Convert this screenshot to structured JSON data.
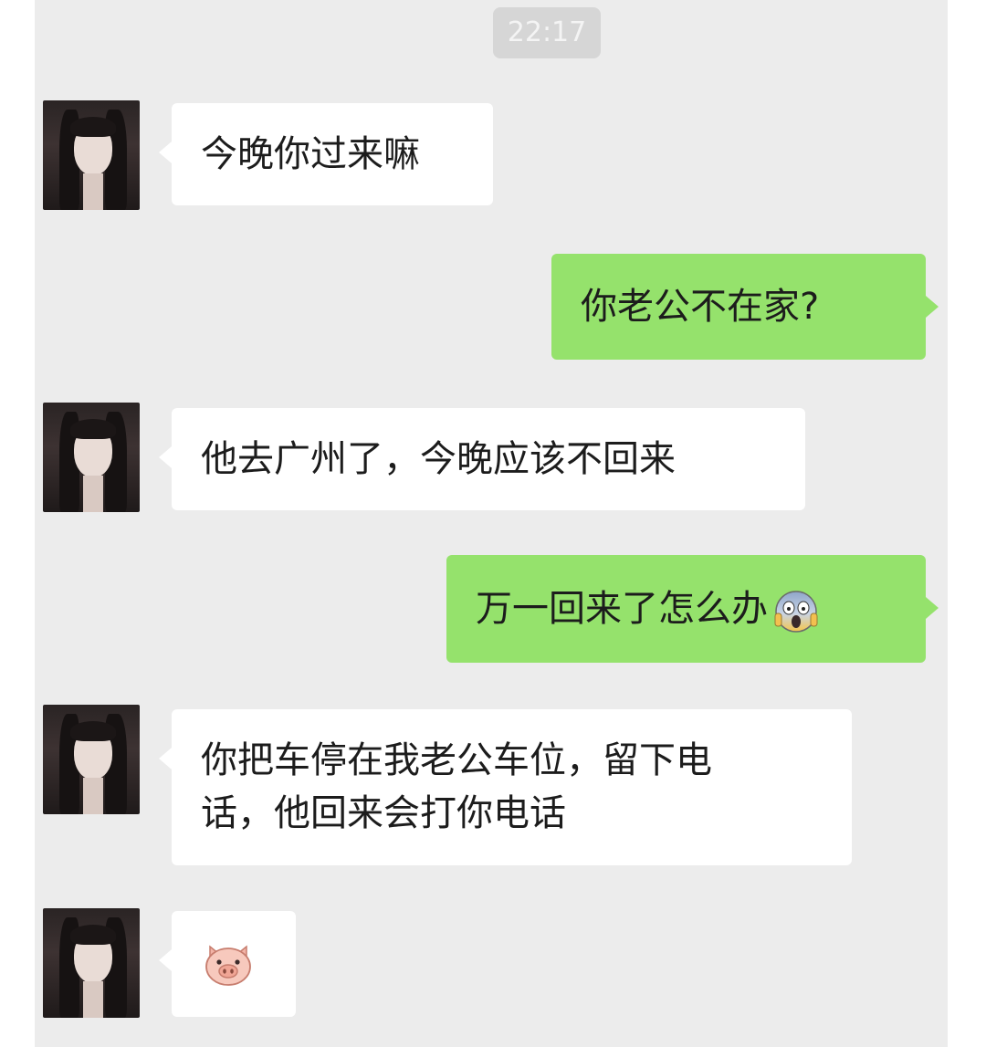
{
  "chat": {
    "timestamp": "22:17",
    "messages": [
      {
        "side": "left",
        "text": "今晚你过来嘛"
      },
      {
        "side": "right",
        "text": "你老公不在家?"
      },
      {
        "side": "left",
        "text": "他去广州了，今晚应该不回来"
      },
      {
        "side": "right",
        "text": "万一回来了怎么办",
        "emoji": "face-screaming-in-fear-icon"
      },
      {
        "side": "left",
        "text_line1": "你把车停在我老公车位，留下电",
        "text_line2": "话，他回来会打你电话"
      },
      {
        "side": "left",
        "emoji": "pig-face-icon"
      }
    ]
  },
  "colors": {
    "chat_background": "#ececec",
    "incoming_bubble": "#ffffff",
    "outgoing_bubble": "#95e26c",
    "timestamp_badge": "#d6d6d6"
  }
}
